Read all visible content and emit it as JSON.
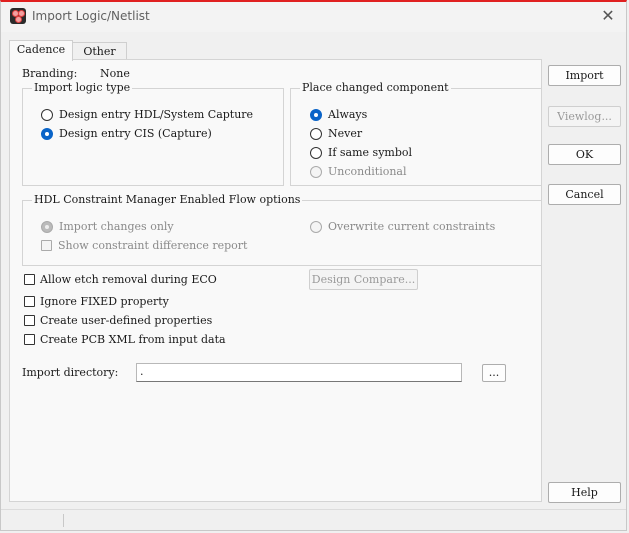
{
  "window": {
    "title": "Import Logic/Netlist",
    "close_glyph": "✕"
  },
  "tabs": [
    {
      "label": "Cadence",
      "active": true
    },
    {
      "label": "Other",
      "active": false
    }
  ],
  "branding": {
    "label": "Branding:",
    "value": "None"
  },
  "import_logic_type": {
    "title": "Import logic type",
    "options": [
      {
        "label": "Design entry HDL/System Capture",
        "selected": false
      },
      {
        "label": "Design entry CIS (Capture)",
        "selected": true
      }
    ]
  },
  "place_changed": {
    "title": "Place changed component",
    "options": [
      {
        "label": "Always",
        "selected": true,
        "enabled": true
      },
      {
        "label": "Never",
        "selected": false,
        "enabled": true
      },
      {
        "label": "If same symbol",
        "selected": false,
        "enabled": true
      },
      {
        "label": "Unconditional",
        "selected": false,
        "enabled": false
      }
    ]
  },
  "hdl_constraint": {
    "title": "HDL Constraint Manager Enabled Flow options",
    "import_changes_only": "Import changes only",
    "overwrite_current": "Overwrite current constraints",
    "show_difference": "Show constraint difference report"
  },
  "options": {
    "allow_etch": "Allow etch removal during ECO",
    "ignore_fixed": "Ignore FIXED property",
    "create_user_defined": "Create user-defined properties",
    "create_pcb_xml": "Create PCB XML from input data",
    "design_compare": "Design Compare..."
  },
  "import_directory": {
    "label": "Import directory:",
    "value": ".",
    "browse": "..."
  },
  "buttons": {
    "import": "Import",
    "viewlog": "Viewlog...",
    "ok": "OK",
    "cancel": "Cancel",
    "help": "Help"
  },
  "colors": {
    "accent": "#0a64c8",
    "title_border": "#e02020"
  }
}
